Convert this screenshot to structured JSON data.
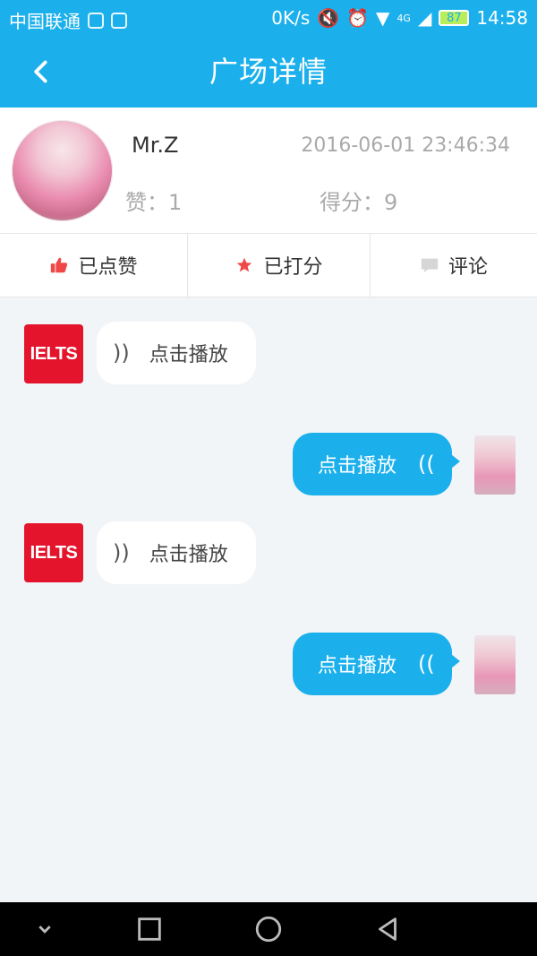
{
  "status_bar": {
    "carrier": "中国联通",
    "speed": "0K/s",
    "network": "4G",
    "battery": "87",
    "time": "14:58"
  },
  "header": {
    "title": "广场详情"
  },
  "profile": {
    "username": "Mr.Z",
    "timestamp": "2016-06-01 23:46:34",
    "likes_label": "赞：1",
    "score_label": "得分：9"
  },
  "actions": [
    {
      "label": "已点赞",
      "icon": "thumbs-up-icon"
    },
    {
      "label": "已打分",
      "icon": "star-icon"
    },
    {
      "label": "评论",
      "icon": "comment-icon"
    }
  ],
  "chat": {
    "bot_avatar_text": "IELTS",
    "messages": [
      {
        "side": "left",
        "label": "点击播放"
      },
      {
        "side": "right",
        "label": "点击播放"
      },
      {
        "side": "left",
        "label": "点击播放"
      },
      {
        "side": "right",
        "label": "点击播放"
      }
    ]
  },
  "colors": {
    "primary": "#1bb0ec",
    "background": "#f2f5f8",
    "ielts_red": "#e3142c",
    "like_red": "#f04848"
  }
}
